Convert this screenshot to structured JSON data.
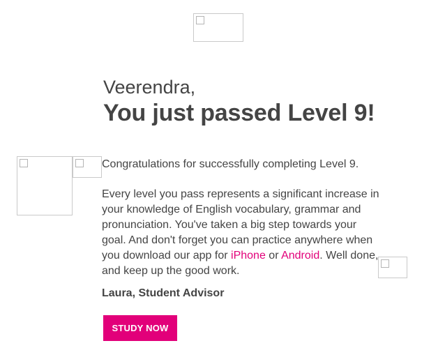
{
  "greeting": "Veerendra,",
  "headline": "You just passed Level 9!",
  "congrats_text": "Congratulations for successfully completing Level 9.",
  "body": {
    "text_before_iphone": "Every level you pass represents a significant increase in your knowledge of English vocabulary, grammar and pronunciation. You've taken a big step towards your goal. And don't forget you can practice anywhere when you download our app for ",
    "iphone_link": "iPhone",
    "text_between": " or ",
    "android_link": "Android",
    "text_after": ". Well done, and keep up the good work."
  },
  "signature": "Laura, Student Advisor",
  "cta_label": "STUDY NOW",
  "colors": {
    "accent": "#e2007a",
    "text": "#444444"
  },
  "icons": {
    "broken_image": "broken-image-icon"
  }
}
